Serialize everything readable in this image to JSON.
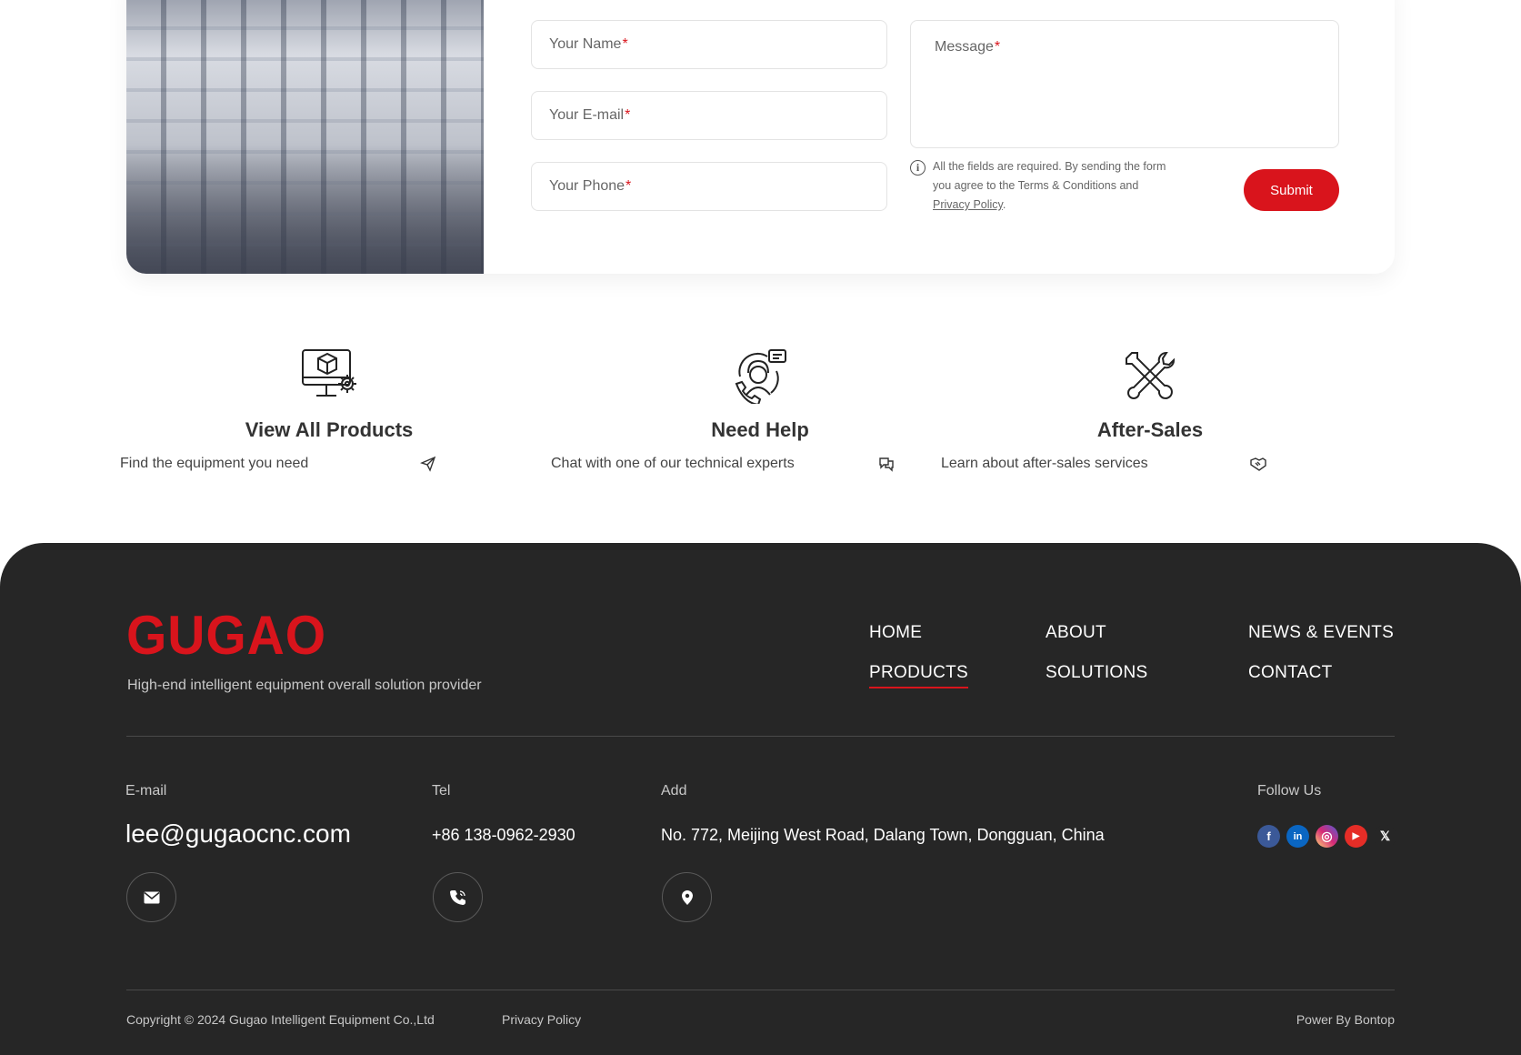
{
  "form": {
    "name_label": "Your Name",
    "email_label": "Your E-mail",
    "phone_label": "Your Phone",
    "message_label": "Message",
    "required_mark": "*",
    "notice_line1": "All the fields are required. By sending the form",
    "notice_line2": "you agree to the Terms & Conditions and",
    "notice_link": "Privacy Policy",
    "notice_end": ".",
    "submit_label": "Submit",
    "accent": "#d9141c"
  },
  "features": [
    {
      "title": "View All Products",
      "text": "Find the equipment you need",
      "icon": "monitor-box-gear-icon",
      "trail_icon": "paper-plane-icon"
    },
    {
      "title": "Need Help",
      "text": "Chat with one of our technical experts",
      "icon": "support-agent-icon",
      "trail_icon": "chat-bubbles-icon"
    },
    {
      "title": "After-Sales",
      "text": "Learn about after-sales services",
      "icon": "wrench-screwdriver-icon",
      "trail_icon": "handshake-icon"
    }
  ],
  "footer": {
    "logo": "GUGAO",
    "tagline": "High-end intelligent equipment overall solution provider",
    "nav": {
      "home": "HOME",
      "about": "ABOUT",
      "news": "NEWS & EVENTS",
      "products": "PRODUCTS",
      "solutions": "SOLUTIONS",
      "contact": "CONTACT"
    },
    "contact": {
      "email_label": "E-mail",
      "email": "lee@gugaocnc.com",
      "tel_label": "Tel",
      "tel": "+86 138-0962-2930",
      "add_label": "Add",
      "address": "No. 772, Meijing West Road, Dalang Town, Dongguan, China",
      "follow_label": "Follow Us"
    },
    "social": [
      {
        "icon": "facebook-icon",
        "glyph": "f",
        "color": "#3b5998"
      },
      {
        "icon": "linkedin-icon",
        "glyph": "in",
        "color": "#0a66c2"
      },
      {
        "icon": "instagram-icon",
        "glyph": "◎",
        "color": "#d62976"
      },
      {
        "icon": "youtube-icon",
        "glyph": "▶",
        "color": "#e52d27"
      },
      {
        "icon": "x-icon",
        "glyph": "𝕏",
        "color": "#262626"
      }
    ],
    "copyright": "Copyright © 2024  Gugao Intelligent Equipment Co.,Ltd",
    "privacy": "Privacy Policy",
    "power": "Power By Bontop",
    "bg": "#262626"
  }
}
